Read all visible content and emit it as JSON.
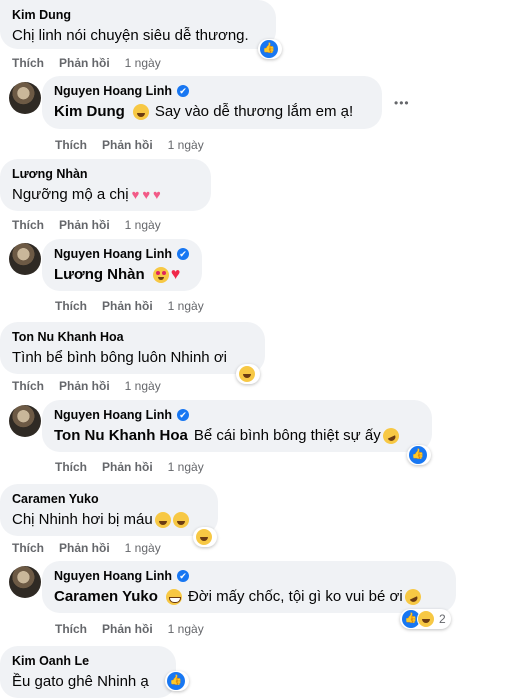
{
  "labels": {
    "like": "Thích",
    "reply": "Phản hồi",
    "verified_mark": "✔",
    "like_mark": "👍",
    "more_mark": "•••"
  },
  "comments": [
    {
      "author": "Kim Dung",
      "text": "Chị linh nói chuyện siêu dễ thương.",
      "time": "1 ngày",
      "reaction": "like"
    },
    {
      "author": "Nguyen Hoang Linh",
      "verified": true,
      "mention": "Kim Dung",
      "emoji_after_mention": "laugh",
      "text": "Say vào dễ thương lắm em ạ!",
      "time": "1 ngày"
    },
    {
      "author": "Lương Nhàn",
      "text": "Ngưỡng mộ a chị",
      "emojis": [
        "pink-heart",
        "pink-heart",
        "pink-heart"
      ],
      "time": "1 ngày"
    },
    {
      "author": "Nguyen Hoang Linh",
      "verified": true,
      "mention": "Lương Nhàn",
      "emojis": [
        "heart-eyes",
        "heart"
      ],
      "time": "1 ngày"
    },
    {
      "author": "Ton Nu Khanh Hoa",
      "text": "Tình bể bình bông luôn Nhinh ơi",
      "time": "1 ngày",
      "reaction": "haha"
    },
    {
      "author": "Nguyen Hoang Linh",
      "verified": true,
      "mention": "Ton Nu Khanh Hoa",
      "text": "Bể cái bình bông thiệt sự ấy",
      "emojis": [
        "rofl"
      ],
      "time": "1 ngày",
      "reaction": "like"
    },
    {
      "author": "Caramen Yuko",
      "text": "Chị Nhinh hơi bị máu",
      "emojis": [
        "laugh",
        "laugh"
      ],
      "time": "1 ngày",
      "reaction": "haha"
    },
    {
      "author": "Nguyen Hoang Linh",
      "verified": true,
      "mention": "Caramen Yuko",
      "emoji_after_mention": "grin",
      "text": "Đời mấy chốc, tội gì ko vui bé ơi",
      "emojis": [
        "rofl"
      ],
      "time": "1 ngày",
      "reaction_count": "2"
    },
    {
      "author": "Kim Oanh Le",
      "text": "Ều gato ghê Nhinh ạ",
      "reaction": "like"
    }
  ]
}
